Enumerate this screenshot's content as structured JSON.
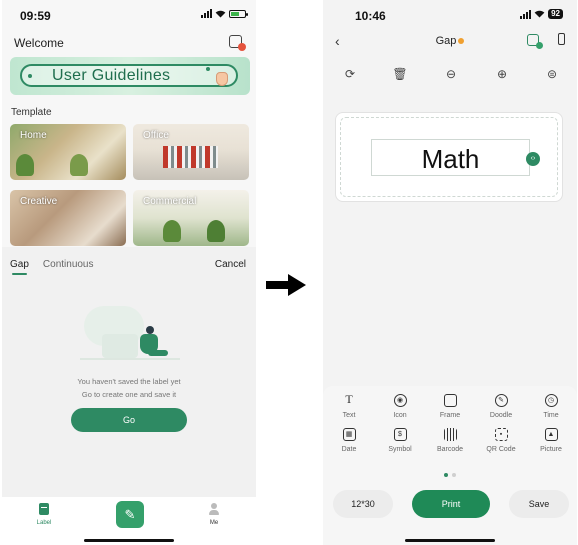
{
  "left_screen": {
    "status_time": "09:59",
    "welcome": "Welcome",
    "banner_label": "User Guidelines",
    "template_heading": "Template",
    "templates": [
      {
        "label": "Home"
      },
      {
        "label": "Office"
      },
      {
        "label": "Creative"
      },
      {
        "label": "Commercial"
      }
    ],
    "sheet": {
      "tab_gap": "Gap",
      "tab_continuous": "Continuous",
      "cancel": "Cancel",
      "message_line1": "You haven't saved the label yet",
      "message_line2": "Go to create one and save it",
      "go_button": "Go"
    },
    "tabbar": {
      "label_tab": "Label",
      "me_tab": "Me"
    }
  },
  "arrow": {
    "icon": "right-arrow-icon"
  },
  "right_screen": {
    "status_time": "10:46",
    "battery_level": "92",
    "title": "Gap",
    "toolbar_icons": [
      "rotate-icon",
      "delete-icon",
      "zoom-out-icon",
      "zoom-in-icon",
      "align-icon"
    ],
    "canvas_text": "Math",
    "elements": [
      {
        "label": "Text",
        "icon": "text-icon"
      },
      {
        "label": "Icon",
        "icon": "icon-icon"
      },
      {
        "label": "Frame",
        "icon": "frame-icon"
      },
      {
        "label": "Doodle",
        "icon": "doodle-icon"
      },
      {
        "label": "Time",
        "icon": "time-icon"
      },
      {
        "label": "Date",
        "icon": "date-icon"
      },
      {
        "label": "Symbol",
        "icon": "symbol-icon"
      },
      {
        "label": "Barcode",
        "icon": "barcode-icon"
      },
      {
        "label": "QR Code",
        "icon": "qr-code-icon"
      },
      {
        "label": "Picture",
        "icon": "picture-icon"
      }
    ],
    "label_size": "12*30",
    "print_button": "Print",
    "save_button": "Save"
  },
  "colors": {
    "accent": "#2e8a63",
    "print": "#1f8a57",
    "badge": "#e5533d",
    "title_dot": "#f0a030"
  }
}
